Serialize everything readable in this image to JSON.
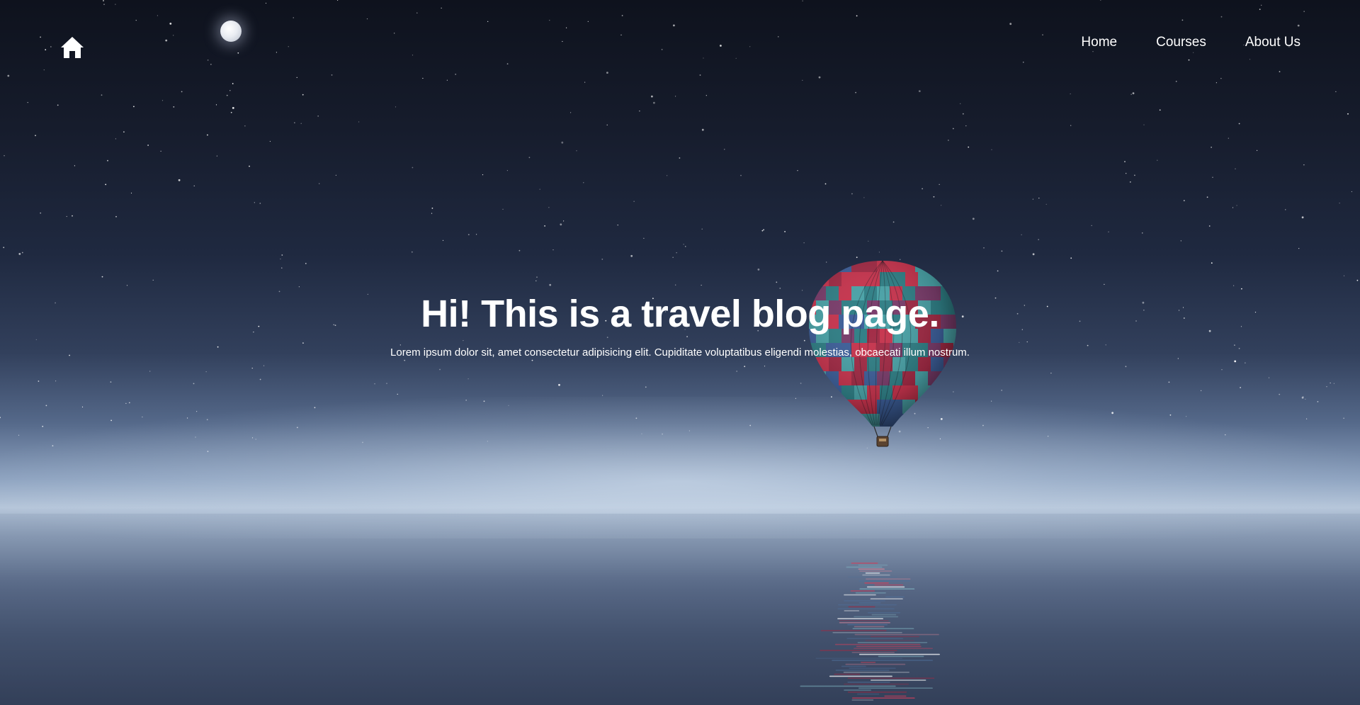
{
  "brand": {
    "logo_icon": "home-icon"
  },
  "nav": {
    "items": [
      {
        "label": "Home"
      },
      {
        "label": "Courses"
      },
      {
        "label": "About Us"
      }
    ]
  },
  "hero": {
    "title": "Hi! This is a travel blog page.",
    "subtitle": "Lorem ipsum dolor sit, amet consectetur adipisicing elit. Cupiditate voluptatibus eligendi molestias, obcaecati illum nostrum.",
    "background_description_icons": [
      "moon-icon",
      "hot-air-balloon-icon"
    ]
  },
  "colors": {
    "text": "#ffffff",
    "sky_top": "#0e121d",
    "horizon": "#b6c6da",
    "water": "#3a4863",
    "balloon_red": "#c8344e",
    "balloon_teal": "#2f7f86"
  }
}
